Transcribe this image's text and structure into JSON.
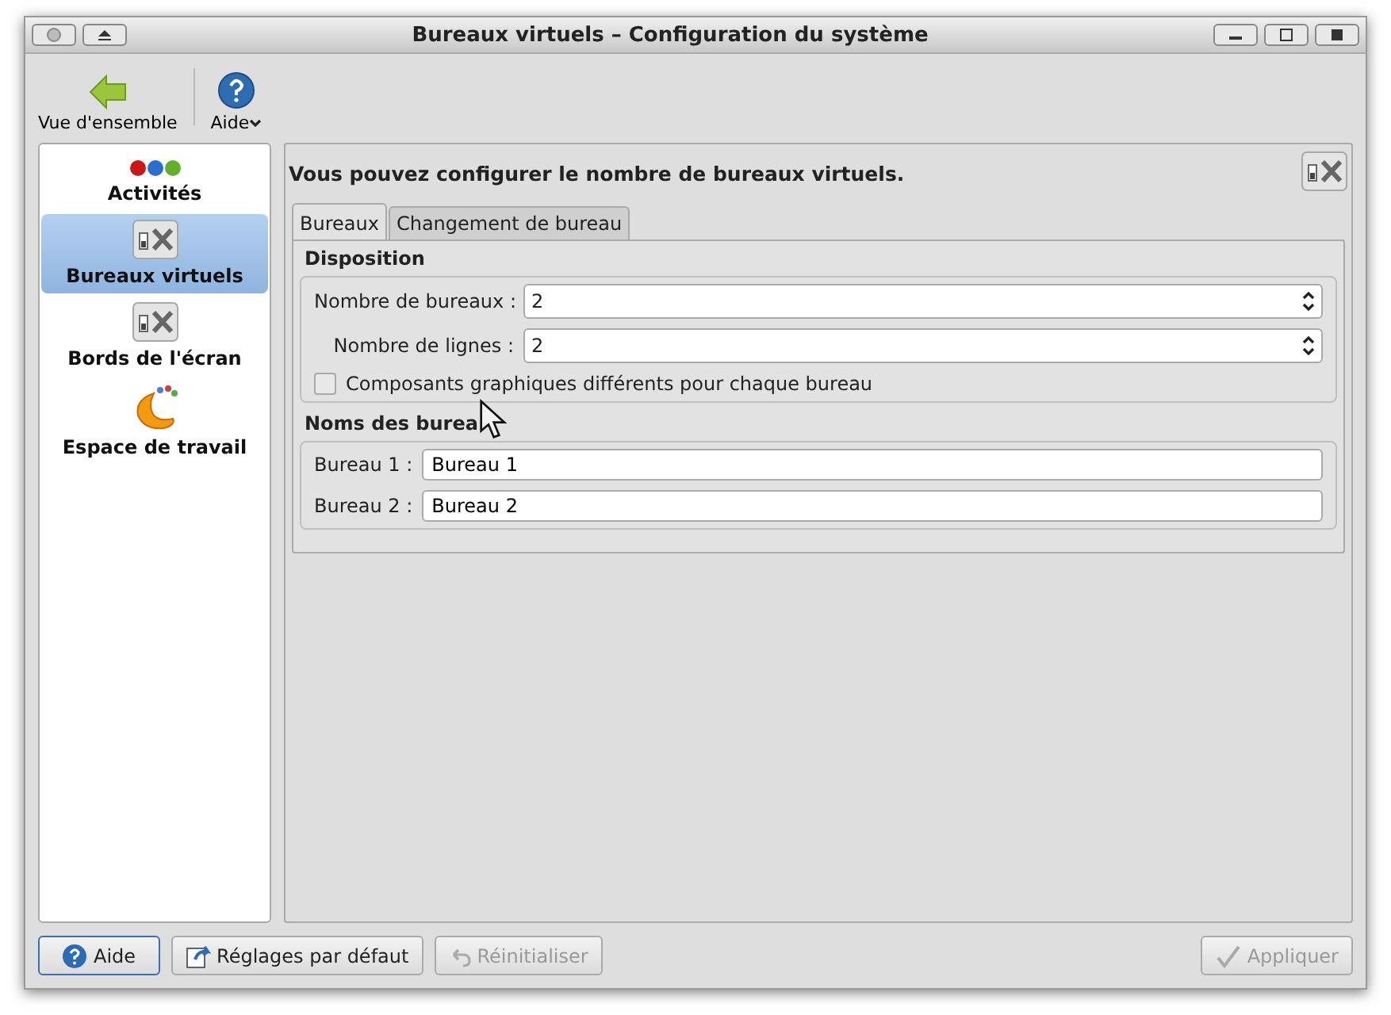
{
  "window": {
    "title": "Bureaux virtuels – Configuration du système"
  },
  "toolbar": [
    {
      "label": "Vue d'ensemble",
      "kind": "back"
    },
    {
      "label": "Aide",
      "kind": "help"
    }
  ],
  "sidebar": {
    "items": [
      {
        "label": "Activités",
        "kind": "dots",
        "selected": false
      },
      {
        "label": "Bureaux virtuels",
        "kind": "tools",
        "selected": true
      },
      {
        "label": "Bords de l'écran",
        "kind": "tools",
        "selected": false
      },
      {
        "label": "Espace de travail",
        "kind": "workspace",
        "selected": false
      }
    ]
  },
  "heading": "Vous pouvez configurer le nombre de bureaux virtuels.",
  "tabs": [
    {
      "label": "Bureaux",
      "selected": true
    },
    {
      "label": "Changement de bureau",
      "selected": false
    }
  ],
  "disposition": {
    "title": "Disposition",
    "spinners": [
      {
        "label": "Nombre de bureaux :",
        "value": "2"
      },
      {
        "label": "Nombre de lignes :",
        "value": "2"
      }
    ],
    "checkbox": {
      "label": "Composants graphiques différents pour chaque bureau",
      "checked": false
    }
  },
  "names": {
    "title": "Noms des burea",
    "fields": [
      {
        "label": "Bureau 1 :",
        "value": "Bureau 1"
      },
      {
        "label": "Bureau 2 :",
        "value": "Bureau 2"
      }
    ]
  },
  "buttons": [
    {
      "label": "Aide",
      "kind": "help",
      "disabled": false
    },
    {
      "label": "Réglages par défaut",
      "kind": "defaults",
      "disabled": false
    },
    {
      "label": "Réinitialiser",
      "kind": "reset",
      "disabled": true
    },
    {
      "label": "Appliquer",
      "kind": "apply",
      "disabled": true
    }
  ]
}
